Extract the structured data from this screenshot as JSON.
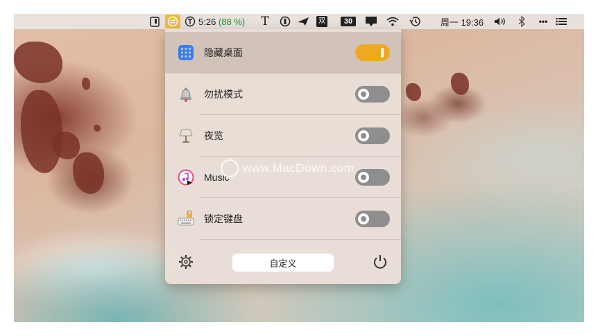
{
  "menubar": {
    "time": "5:26",
    "battery_pct": "(88 %)",
    "text_icon": "T",
    "shuang": "双",
    "calendar_day": "30",
    "datetime": "周一 19:36",
    "more": "•••"
  },
  "panel": {
    "items": [
      {
        "label": "隐藏桌面",
        "icon": "grid-icon",
        "enabled": true
      },
      {
        "label": "勿扰模式",
        "icon": "bell-icon",
        "enabled": false
      },
      {
        "label": "夜览",
        "icon": "lamp-icon",
        "enabled": false
      },
      {
        "label": "Music",
        "icon": "music-icon",
        "enabled": false
      },
      {
        "label": "锁定键盘",
        "icon": "keyboard-lock-icon",
        "enabled": false
      }
    ],
    "custom_button": "自定义"
  },
  "watermark": "www.MacDown.com",
  "colors": {
    "accent": "#f0a823",
    "toggle_off": "#8e8e8e"
  }
}
